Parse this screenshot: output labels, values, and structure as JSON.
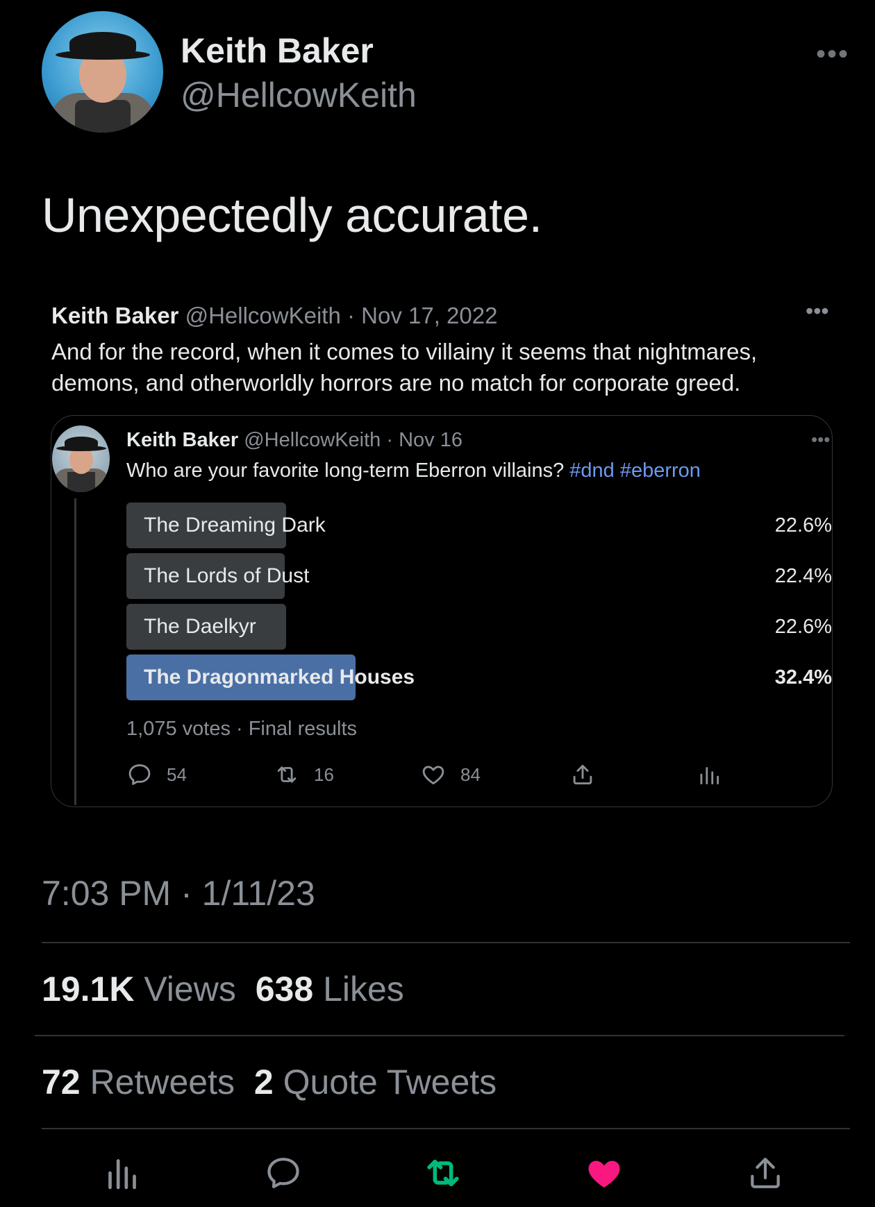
{
  "author": {
    "name": "Keith Baker",
    "handle": "@HellcowKeith"
  },
  "tweet": {
    "text": "Unexpectedly accurate."
  },
  "quoted": {
    "name": "Keith Baker",
    "meta": "@HellcowKeith · Nov 17, 2022",
    "text": "And for the record, when it comes to villainy it seems that nightmares, demons, and otherworldly horrors are no match for corporate greed.",
    "inner": {
      "name": "Keith Baker",
      "meta": "@HellcowKeith · Nov 16",
      "text": "Who are your favorite long-term Eberron villains?",
      "hashtags": "#dnd #eberron",
      "poll": [
        {
          "label": "The Dreaming Dark",
          "pct": "22.6%",
          "value": 22.6,
          "winner": false
        },
        {
          "label": "The Lords of Dust",
          "pct": "22.4%",
          "value": 22.4,
          "winner": false
        },
        {
          "label": "The Daelkyr",
          "pct": "22.6%",
          "value": 22.6,
          "winner": false
        },
        {
          "label": "The Dragonmarked Houses",
          "pct": "32.4%",
          "value": 32.4,
          "winner": true
        }
      ],
      "summary": "1,075 votes · Final results",
      "actions": {
        "replies": "54",
        "retweets": "16",
        "likes": "84"
      }
    }
  },
  "timestamp": "7:03 PM · 1/11/23",
  "stats": {
    "views_count": "19.1K",
    "views_label": "Views",
    "likes_count": "638",
    "likes_label": "Likes",
    "retweets_count": "72",
    "retweets_label": "Retweets",
    "quotes_count": "2",
    "quotes_label": "Quote Tweets"
  },
  "colors": {
    "background": "#000000",
    "text": "#e7e9ea",
    "muted": "#8b9097",
    "link": "#6b9af0",
    "poll_winner": "#4a6fa5",
    "poll_other": "#3a3d40",
    "retweet_active": "#00ba7c",
    "like_active": "#f91880"
  },
  "icons": {
    "top_more": "more-horizontal-icon",
    "bar": [
      "analytics-icon",
      "reply-icon",
      "retweet-icon",
      "like-icon",
      "share-icon"
    ]
  }
}
